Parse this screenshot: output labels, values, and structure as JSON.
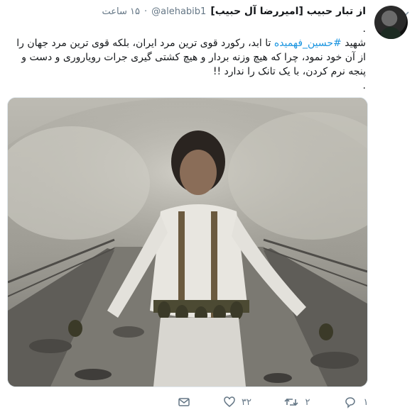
{
  "tweet": {
    "author_name": "از تبار حبیب [امیررضا آل حبیب]",
    "handle": "@alehabib1",
    "separator": "·",
    "time": "۱۵ ساعت",
    "text": {
      "line1": ".",
      "prefix": "شهید ",
      "hashtag": "#حسین_فهمیده",
      "rest": " تا ابد، رکورد قوی ترین مرد ایران، بلکه قوی ترین مرد جهان را از آن خود نمود، چرا که هیچ وزنه بردار و هیچ کشتی گیری جرات رویاروری و دست و پنجه نرم کردن، با یک تانک را ندارد !!",
      "last_line": "."
    },
    "media_alt": "photo",
    "actions": {
      "reply_count": "۱",
      "retweet_count": "۲",
      "like_count": "۳۲"
    },
    "icons": {
      "reply": "reply-icon",
      "retweet": "retweet-icon",
      "like": "heart-icon",
      "message": "envelope-icon",
      "dropdown": "chevron-down-icon"
    },
    "colors": {
      "hashtag": "#1b95e0",
      "secondary_text": "#657786"
    }
  }
}
